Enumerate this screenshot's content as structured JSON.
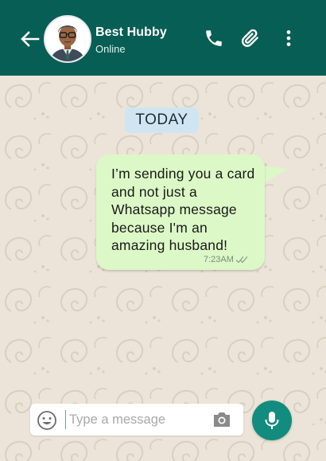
{
  "header": {
    "contact_name": "Best Hubby",
    "contact_status": "Online",
    "icons": [
      "back-arrow-icon",
      "avatar",
      "phone-icon",
      "paperclip-icon",
      "more-options-icon"
    ],
    "color": "#075e54"
  },
  "chat": {
    "date_chip": "TODAY",
    "messages": [
      {
        "text": "I’m sending you a card and not just a Whatsapp message because I'm an amazing husband!",
        "time": "7:23AM",
        "status": "read-double-check",
        "direction": "outgoing",
        "bubble_color": "#dcf8c6"
      }
    ]
  },
  "composer": {
    "placeholder": "Type a message",
    "value": "",
    "icons": [
      "emoji-icon",
      "camera-icon",
      "microphone-icon"
    ],
    "mic_color": "#128c7e"
  }
}
